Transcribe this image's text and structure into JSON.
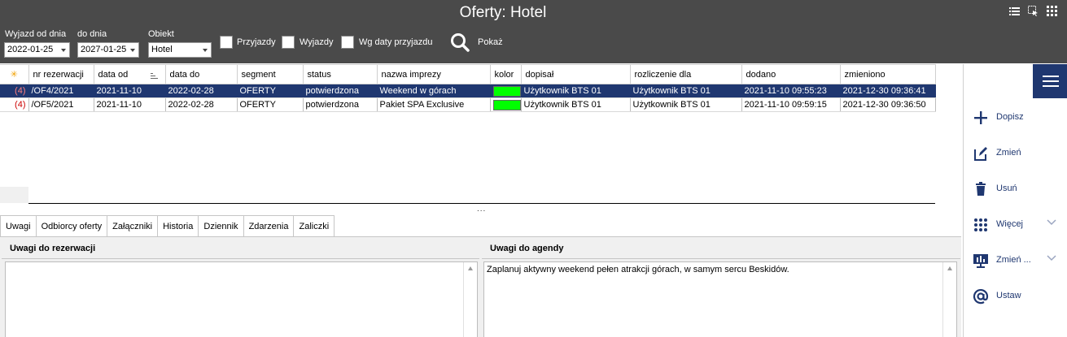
{
  "window": {
    "title": "Oferty: Hotel"
  },
  "filters": {
    "wyjazd_od_label": "Wyjazd od dnia",
    "wyjazd_od_value": "2022-01-25",
    "do_dnia_label": "do dnia",
    "do_dnia_value": "2027-01-25",
    "obiekt_label": "Obiekt",
    "obiekt_value": "Hotel",
    "przyjazdy_label": "Przyjazdy",
    "wyjazdy_label": "Wyjazdy",
    "wg_daty_label": "Wg daty przyjazdu",
    "pokaz_label": "Pokaż"
  },
  "table": {
    "star": "✳",
    "columns": [
      "nr rezerwacji",
      "data od",
      "data do",
      "segment",
      "status",
      "nazwa imprezy",
      "kolor",
      "dopisał",
      "rozliczenie dla",
      "dodano",
      "zmieniono"
    ],
    "rows": [
      {
        "count": "(4)",
        "nr": "/OF4/2021",
        "data_od": "2021-11-10",
        "data_do": "2022-02-28",
        "segment": "OFERTY",
        "status": "potwierdzona",
        "nazwa": "Weekend w górach",
        "kolor": "#00ff00",
        "dopisal": "Użytkownik BTS 01",
        "rozliczenie": "Użytkownik BTS 01",
        "dodano": "2021-11-10 09:55:23",
        "zmieniono": "2021-12-30 09:36:41"
      },
      {
        "count": "(4)",
        "nr": "/OF5/2021",
        "data_od": "2021-11-10",
        "data_do": "2022-02-28",
        "segment": "OFERTY",
        "status": "potwierdzona",
        "nazwa": "Pakiet SPA Exclusive",
        "kolor": "#00ff00",
        "dopisal": "Użytkownik BTS 01",
        "rozliczenie": "Użytkownik BTS 01",
        "dodano": "2021-11-10 09:59:15",
        "zmieniono": "2021-12-30 09:36:50"
      }
    ]
  },
  "splitter": "...",
  "tabs": [
    "Uwagi",
    "Odbiorcy oferty",
    "Załączniki",
    "Historia",
    "Dziennik",
    "Zdarzenia",
    "Zaliczki"
  ],
  "panels": {
    "uwagi_rez_title": "Uwagi do rezerwacji",
    "uwagi_rez_text": "",
    "uwagi_agendy_title": "Uwagi do agendy",
    "uwagi_agendy_text": "Zaplanuj aktywny weekend pełen atrakcji górach, w samym sercu Beskidów."
  },
  "sidebar": {
    "dopisz": "Dopisz",
    "zmien": "Zmień",
    "usun": "Usuń",
    "wiecej": "Więcej",
    "zmien2": "Zmień ...",
    "ustaw": "Ustaw"
  },
  "colors": {
    "accent": "#1f3770",
    "topbar": "#4a4a4a",
    "row_color": "#00ff00"
  }
}
